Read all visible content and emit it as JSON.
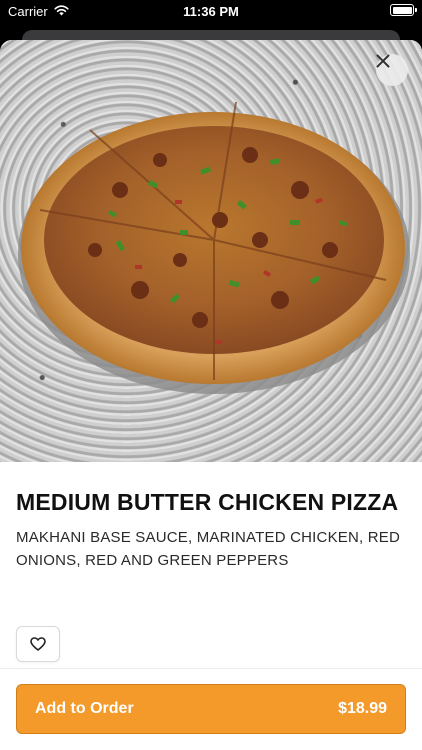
{
  "status_bar": {
    "carrier": "Carrier",
    "time": "11:36 PM"
  },
  "product": {
    "title": "MEDIUM BUTTER CHICKEN PIZZA",
    "description": "MAKHANI BASE SAUCE, MARINATED CHICKEN, RED ONIONS, RED AND GREEN PEPPERS",
    "price": "$18.99"
  },
  "actions": {
    "add_to_order_label": "Add to Order"
  },
  "colors": {
    "accent": "#f39a2b",
    "accent_border": "#d27e17"
  },
  "icons": {
    "close": "close-icon",
    "favorite": "heart-outline-icon",
    "wifi": "wifi-icon",
    "battery": "battery-icon"
  }
}
